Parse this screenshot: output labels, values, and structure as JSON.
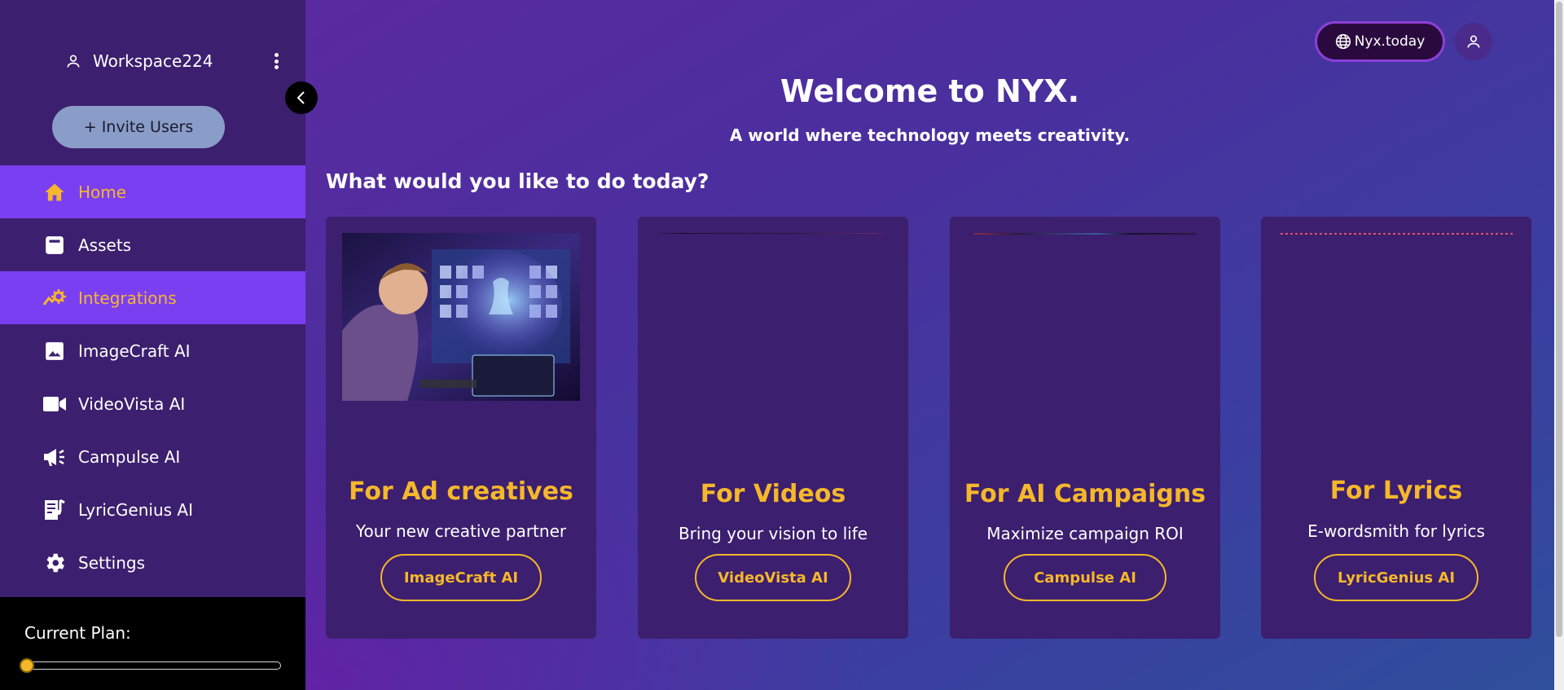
{
  "sidebar": {
    "workspace_name": "Workspace224",
    "invite_label": "+ Invite Users",
    "items": [
      {
        "label": "Home",
        "icon": "home-icon"
      },
      {
        "label": "Assets",
        "icon": "assets-icon"
      },
      {
        "label": "Integrations",
        "icon": "integrations-icon"
      },
      {
        "label": "ImageCraft AI",
        "icon": "image-icon"
      },
      {
        "label": "VideoVista AI",
        "icon": "video-camera-icon"
      },
      {
        "label": "Campulse AI",
        "icon": "megaphone-icon"
      },
      {
        "label": "LyricGenius AI",
        "icon": "lyrics-icon"
      },
      {
        "label": "Settings",
        "icon": "gear-icon"
      }
    ],
    "plan_label": "Current Plan:",
    "plan_level": 0
  },
  "header": {
    "site_button": "Nyx.today"
  },
  "main": {
    "welcome": "Welcome to NYX.",
    "tagline": "A world where technology meets creativity.",
    "question": "What would you like to do today?",
    "cards": [
      {
        "title": "For Ad creatives",
        "subtitle": "Your new creative partner",
        "button": "ImageCraft AI"
      },
      {
        "title": "For Videos",
        "subtitle": "Bring your vision to life",
        "button": "VideoVista AI"
      },
      {
        "title": "For AI Campaigns",
        "subtitle": "Maximize campaign ROI",
        "button": "Campulse AI"
      },
      {
        "title": "For Lyrics",
        "subtitle": "E-wordsmith for lyrics",
        "button": "LyricGenius AI"
      }
    ]
  },
  "colors": {
    "accent": "#f5b72b",
    "active_nav": "#7b3ff2",
    "sidebar_bg": "#3c1f6e",
    "card_bg": "#3c1f6e"
  }
}
